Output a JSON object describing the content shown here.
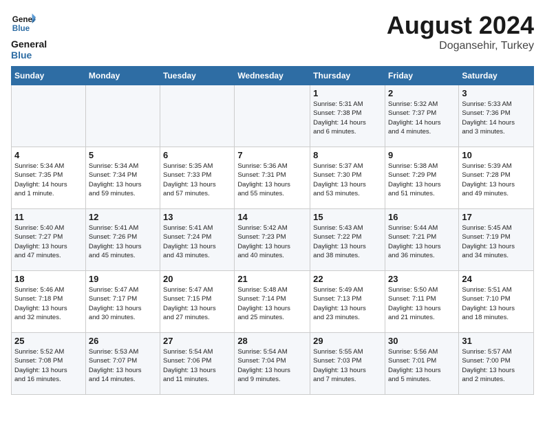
{
  "header": {
    "logo_general": "General",
    "logo_blue": "Blue",
    "month": "August 2024",
    "location": "Dogansehir, Turkey"
  },
  "days_of_week": [
    "Sunday",
    "Monday",
    "Tuesday",
    "Wednesday",
    "Thursday",
    "Friday",
    "Saturday"
  ],
  "weeks": [
    [
      {
        "num": "",
        "info": ""
      },
      {
        "num": "",
        "info": ""
      },
      {
        "num": "",
        "info": ""
      },
      {
        "num": "",
        "info": ""
      },
      {
        "num": "1",
        "info": "Sunrise: 5:31 AM\nSunset: 7:38 PM\nDaylight: 14 hours\nand 6 minutes."
      },
      {
        "num": "2",
        "info": "Sunrise: 5:32 AM\nSunset: 7:37 PM\nDaylight: 14 hours\nand 4 minutes."
      },
      {
        "num": "3",
        "info": "Sunrise: 5:33 AM\nSunset: 7:36 PM\nDaylight: 14 hours\nand 3 minutes."
      }
    ],
    [
      {
        "num": "4",
        "info": "Sunrise: 5:34 AM\nSunset: 7:35 PM\nDaylight: 14 hours\nand 1 minute."
      },
      {
        "num": "5",
        "info": "Sunrise: 5:34 AM\nSunset: 7:34 PM\nDaylight: 13 hours\nand 59 minutes."
      },
      {
        "num": "6",
        "info": "Sunrise: 5:35 AM\nSunset: 7:33 PM\nDaylight: 13 hours\nand 57 minutes."
      },
      {
        "num": "7",
        "info": "Sunrise: 5:36 AM\nSunset: 7:31 PM\nDaylight: 13 hours\nand 55 minutes."
      },
      {
        "num": "8",
        "info": "Sunrise: 5:37 AM\nSunset: 7:30 PM\nDaylight: 13 hours\nand 53 minutes."
      },
      {
        "num": "9",
        "info": "Sunrise: 5:38 AM\nSunset: 7:29 PM\nDaylight: 13 hours\nand 51 minutes."
      },
      {
        "num": "10",
        "info": "Sunrise: 5:39 AM\nSunset: 7:28 PM\nDaylight: 13 hours\nand 49 minutes."
      }
    ],
    [
      {
        "num": "11",
        "info": "Sunrise: 5:40 AM\nSunset: 7:27 PM\nDaylight: 13 hours\nand 47 minutes."
      },
      {
        "num": "12",
        "info": "Sunrise: 5:41 AM\nSunset: 7:26 PM\nDaylight: 13 hours\nand 45 minutes."
      },
      {
        "num": "13",
        "info": "Sunrise: 5:41 AM\nSunset: 7:24 PM\nDaylight: 13 hours\nand 43 minutes."
      },
      {
        "num": "14",
        "info": "Sunrise: 5:42 AM\nSunset: 7:23 PM\nDaylight: 13 hours\nand 40 minutes."
      },
      {
        "num": "15",
        "info": "Sunrise: 5:43 AM\nSunset: 7:22 PM\nDaylight: 13 hours\nand 38 minutes."
      },
      {
        "num": "16",
        "info": "Sunrise: 5:44 AM\nSunset: 7:21 PM\nDaylight: 13 hours\nand 36 minutes."
      },
      {
        "num": "17",
        "info": "Sunrise: 5:45 AM\nSunset: 7:19 PM\nDaylight: 13 hours\nand 34 minutes."
      }
    ],
    [
      {
        "num": "18",
        "info": "Sunrise: 5:46 AM\nSunset: 7:18 PM\nDaylight: 13 hours\nand 32 minutes."
      },
      {
        "num": "19",
        "info": "Sunrise: 5:47 AM\nSunset: 7:17 PM\nDaylight: 13 hours\nand 30 minutes."
      },
      {
        "num": "20",
        "info": "Sunrise: 5:47 AM\nSunset: 7:15 PM\nDaylight: 13 hours\nand 27 minutes."
      },
      {
        "num": "21",
        "info": "Sunrise: 5:48 AM\nSunset: 7:14 PM\nDaylight: 13 hours\nand 25 minutes."
      },
      {
        "num": "22",
        "info": "Sunrise: 5:49 AM\nSunset: 7:13 PM\nDaylight: 13 hours\nand 23 minutes."
      },
      {
        "num": "23",
        "info": "Sunrise: 5:50 AM\nSunset: 7:11 PM\nDaylight: 13 hours\nand 21 minutes."
      },
      {
        "num": "24",
        "info": "Sunrise: 5:51 AM\nSunset: 7:10 PM\nDaylight: 13 hours\nand 18 minutes."
      }
    ],
    [
      {
        "num": "25",
        "info": "Sunrise: 5:52 AM\nSunset: 7:08 PM\nDaylight: 13 hours\nand 16 minutes."
      },
      {
        "num": "26",
        "info": "Sunrise: 5:53 AM\nSunset: 7:07 PM\nDaylight: 13 hours\nand 14 minutes."
      },
      {
        "num": "27",
        "info": "Sunrise: 5:54 AM\nSunset: 7:06 PM\nDaylight: 13 hours\nand 11 minutes."
      },
      {
        "num": "28",
        "info": "Sunrise: 5:54 AM\nSunset: 7:04 PM\nDaylight: 13 hours\nand 9 minutes."
      },
      {
        "num": "29",
        "info": "Sunrise: 5:55 AM\nSunset: 7:03 PM\nDaylight: 13 hours\nand 7 minutes."
      },
      {
        "num": "30",
        "info": "Sunrise: 5:56 AM\nSunset: 7:01 PM\nDaylight: 13 hours\nand 5 minutes."
      },
      {
        "num": "31",
        "info": "Sunrise: 5:57 AM\nSunset: 7:00 PM\nDaylight: 13 hours\nand 2 minutes."
      }
    ]
  ]
}
